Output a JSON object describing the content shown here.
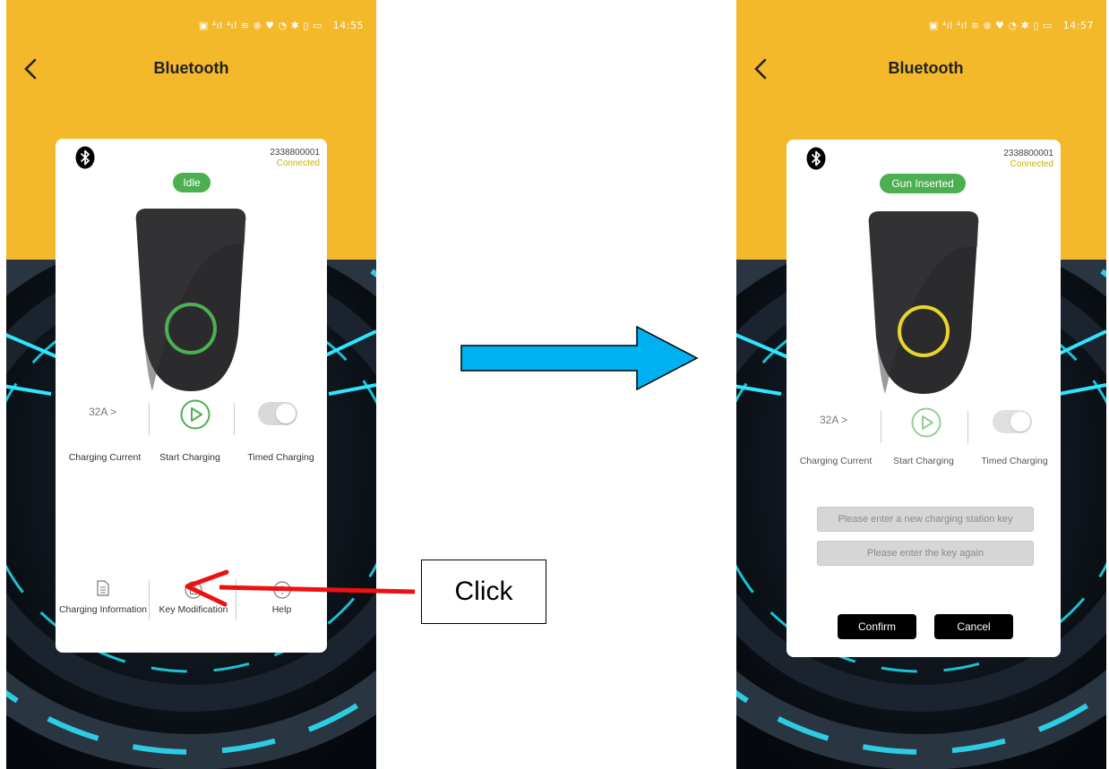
{
  "left_screen": {
    "status_time": "14:55",
    "header": {
      "title": "Bluetooth"
    },
    "device": {
      "id": "2338800001",
      "connection": "Connected"
    },
    "status_badge": "Idle",
    "ring_color": "#4caf50",
    "controls": {
      "charging_current": {
        "value": "32A >",
        "label": "Charging Current"
      },
      "start_charging": {
        "label": "Start Charging"
      },
      "timed_charging": {
        "label": "Timed Charging"
      }
    },
    "bottom_menu": {
      "charging_information": "Charging Information",
      "key_modification": "Key Modification",
      "help": "Help"
    }
  },
  "right_screen": {
    "status_time": "14:57",
    "header": {
      "title": "Bluetooth"
    },
    "device": {
      "id": "2338800001",
      "connection": "Connected"
    },
    "status_badge": "Gun Inserted",
    "ring_color": "#e8d62a",
    "controls": {
      "charging_current": {
        "value": "32A >",
        "label": "Charging Current"
      },
      "start_charging": {
        "label": "Start Charging"
      },
      "timed_charging": {
        "label": "Timed Charging"
      }
    },
    "key_form": {
      "new_key_placeholder": "Please enter a new charging station key",
      "repeat_key_placeholder": "Please enter the key again",
      "confirm_label": "Confirm",
      "cancel_label": "Cancel"
    }
  },
  "annotation": {
    "callout_text": "Click",
    "flow_arrow_color": "#00b0f0",
    "pointer_arrow_color": "#ee1111"
  },
  "icons": [
    "bluetooth-icon",
    "back-chevron-icon",
    "play-icon",
    "document-icon",
    "lock-icon",
    "help-icon"
  ]
}
